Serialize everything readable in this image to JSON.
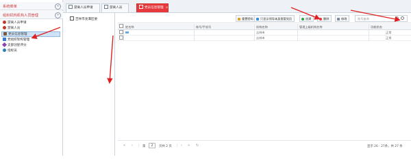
{
  "sidebar": {
    "sections": [
      {
        "title": "系统菜单"
      },
      {
        "title": "组织机构机构人员管理"
      }
    ],
    "items": [
      {
        "label": "游离人员申请",
        "icon": "person-icon",
        "color": "#c0392b"
      },
      {
        "label": "游离人员",
        "icon": "person-icon",
        "color": "#c0392b"
      },
      {
        "label": "党员信息管理",
        "icon": "person-group-icon",
        "color": "#7a5c3c"
      },
      {
        "label": "党组织架构管理",
        "icon": "org-icon",
        "color": "#3a7bd5"
      },
      {
        "label": "支部创星评分",
        "icon": "star-icon",
        "color": "#8e44ad"
      },
      {
        "label": "指标员",
        "icon": "globe-icon",
        "color": "#2c7fb8"
      }
    ]
  },
  "tabs": [
    {
      "label": "游离人员申请"
    },
    {
      "label": "游离人员"
    },
    {
      "label": "党员信息管理"
    }
  ],
  "middle_tree": {
    "root_label": "吉林市龙潭区委"
  },
  "toolbar": {
    "reset_password": "重置密码",
    "show_only": "只显示领导本身直管党员",
    "add": "创建",
    "delete": "删除",
    "edit": "修改",
    "search_placeholder": "账号查询"
  },
  "table": {
    "columns": [
      "姓名称",
      "帐号/手机号",
      "机构名称",
      "管理上级机构名称",
      "功能状态"
    ],
    "rows": [
      {
        "name": "",
        "account": "",
        "org": "吉林市",
        "parent_org": "",
        "status": "正常"
      },
      {
        "name": "",
        "account": "",
        "org": "吉林市",
        "parent_org": "",
        "status": "正常"
      }
    ]
  },
  "pager": {
    "page_value": "2",
    "page_total_text": "页共 2 页",
    "summary": "显示 26 - 27条，共 27 条"
  },
  "colors": {
    "accent_red": "#e5393b",
    "selection_blue": "#cfe3f7",
    "annotation_red": "#e02020"
  }
}
